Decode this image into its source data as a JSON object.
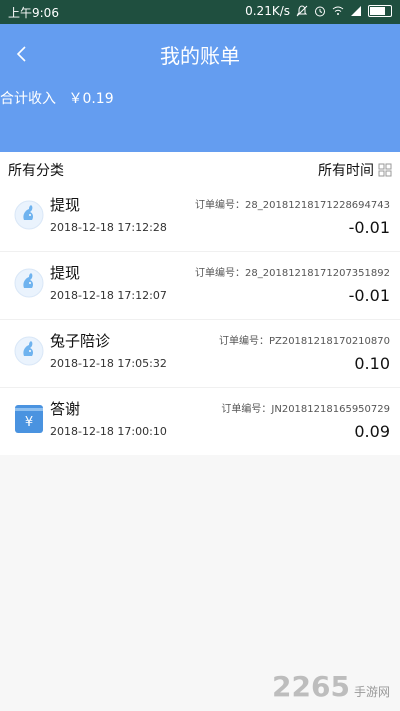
{
  "statusbar": {
    "time": "上午9:06",
    "network_speed": "0.21K/s"
  },
  "header": {
    "title": "我的账单",
    "total_label": "合计收入",
    "total_amount": "￥0.19",
    "bg_color": "#649df0"
  },
  "filters": {
    "category": "所有分类",
    "time": "所有时间"
  },
  "records": [
    {
      "icon": "rabbit-icon",
      "name": "提现",
      "date": "2018-12-18 17:12:28",
      "order": "订单编号：28_20181218171228694743",
      "amount": "-0.01"
    },
    {
      "icon": "rabbit-icon",
      "name": "提现",
      "date": "2018-12-18 17:12:07",
      "order": "订单编号：28_20181218171207351892",
      "amount": "-0.01"
    },
    {
      "icon": "rabbit-icon",
      "name": "兔子陪诊",
      "date": "2018-12-18 17:05:32",
      "order": "订单编号：PZ20181218170210870",
      "amount": "0.10"
    },
    {
      "icon": "yen-card-icon",
      "name": "答谢",
      "date": "2018-12-18 17:00:10",
      "order": "订单编号：JN20181218165950729",
      "amount": "0.09"
    }
  ],
  "watermark": {
    "brand": "2265",
    "sub": "手游网"
  }
}
